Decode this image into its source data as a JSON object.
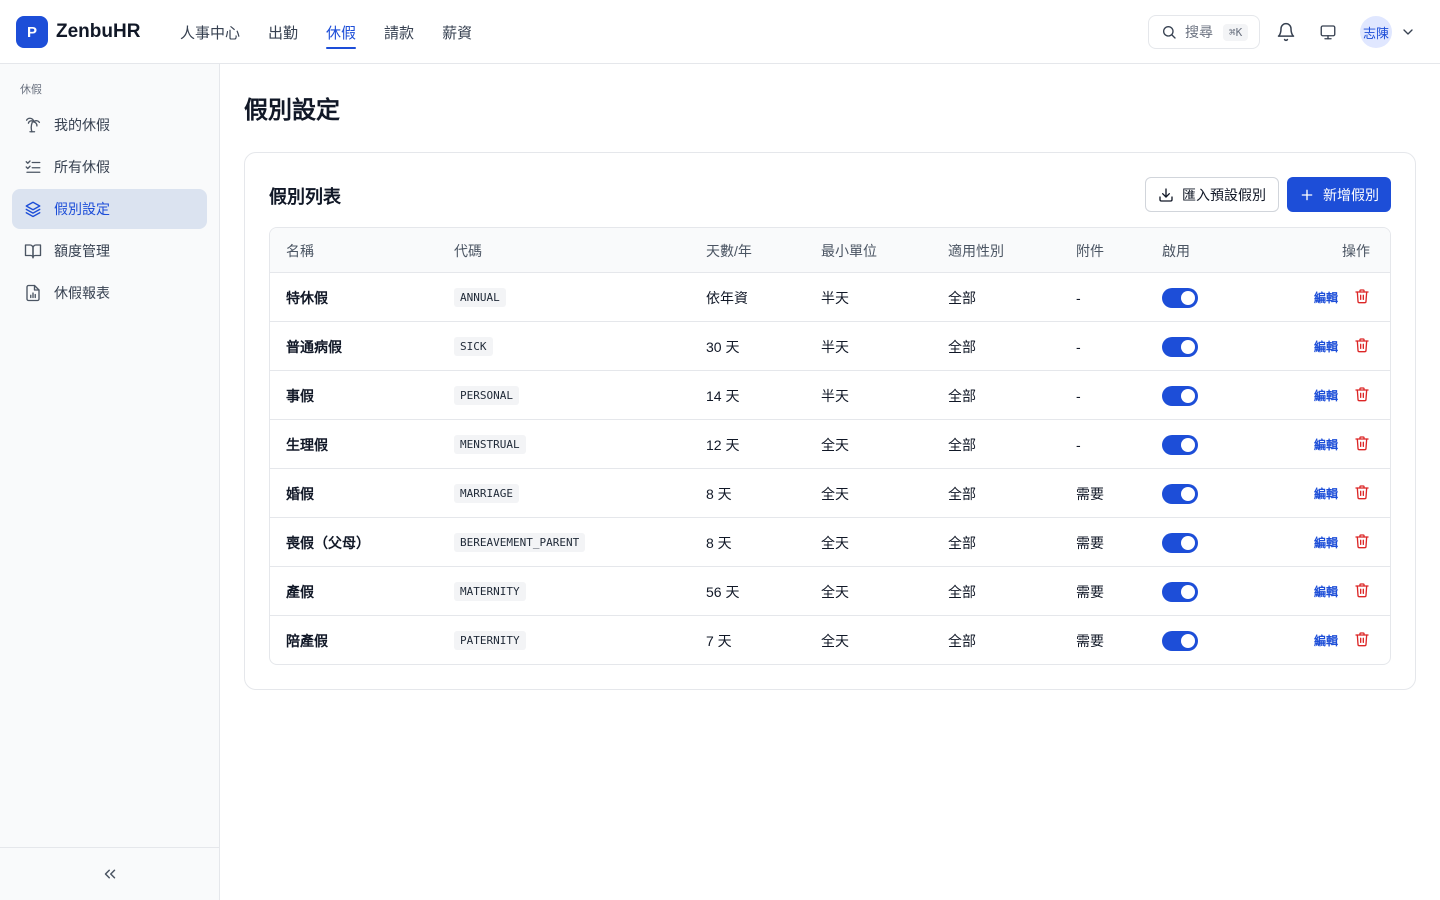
{
  "app": {
    "logo_letter": "P",
    "name": "ZenbuHR"
  },
  "topnav": [
    {
      "label": "人事中心",
      "active": false
    },
    {
      "label": "出勤",
      "active": false
    },
    {
      "label": "休假",
      "active": true
    },
    {
      "label": "請款",
      "active": false
    },
    {
      "label": "薪資",
      "active": false
    }
  ],
  "header": {
    "search_label": "搜尋",
    "search_shortcut": "⌘K",
    "user_name": "志陳"
  },
  "sidebar": {
    "section": "休假",
    "items": [
      {
        "label": "我的休假",
        "icon": "palm-tree-icon",
        "active": false
      },
      {
        "label": "所有休假",
        "icon": "list-check-icon",
        "active": false
      },
      {
        "label": "假別設定",
        "icon": "layers-icon",
        "active": true
      },
      {
        "label": "額度管理",
        "icon": "book-open-icon",
        "active": false
      },
      {
        "label": "休假報表",
        "icon": "report-icon",
        "active": false
      }
    ]
  },
  "page": {
    "title": "假別設定"
  },
  "card": {
    "title": "假別列表",
    "import_label": "匯入預設假別",
    "add_label": "新增假別"
  },
  "table": {
    "columns": {
      "name": "名稱",
      "code": "代碼",
      "days": "天數/年",
      "unit": "最小單位",
      "gender": "適用性別",
      "attachment": "附件",
      "enabled": "啟用",
      "actions": "操作"
    },
    "edit_label": "編輯",
    "rows": [
      {
        "name": "特休假",
        "code": "ANNUAL",
        "days": "依年資",
        "unit": "半天",
        "gender": "全部",
        "attachment": "-",
        "enabled": true
      },
      {
        "name": "普通病假",
        "code": "SICK",
        "days": "30 天",
        "unit": "半天",
        "gender": "全部",
        "attachment": "-",
        "enabled": true
      },
      {
        "name": "事假",
        "code": "PERSONAL",
        "days": "14 天",
        "unit": "半天",
        "gender": "全部",
        "attachment": "-",
        "enabled": true
      },
      {
        "name": "生理假",
        "code": "MENSTRUAL",
        "days": "12 天",
        "unit": "全天",
        "gender": "全部",
        "attachment": "-",
        "enabled": true
      },
      {
        "name": "婚假",
        "code": "MARRIAGE",
        "days": "8 天",
        "unit": "全天",
        "gender": "全部",
        "attachment": "需要",
        "enabled": true
      },
      {
        "name": "喪假（父母）",
        "code": "BEREAVEMENT_PARENT",
        "days": "8 天",
        "unit": "全天",
        "gender": "全部",
        "attachment": "需要",
        "enabled": true
      },
      {
        "name": "產假",
        "code": "MATERNITY",
        "days": "56 天",
        "unit": "全天",
        "gender": "全部",
        "attachment": "需要",
        "enabled": true
      },
      {
        "name": "陪產假",
        "code": "PATERNITY",
        "days": "7 天",
        "unit": "全天",
        "gender": "全部",
        "attachment": "需要",
        "enabled": true
      }
    ]
  },
  "colors": {
    "primary": "#1d4ed8",
    "danger": "#dc2626",
    "sidebar_active_bg": "#dbe3f0"
  }
}
